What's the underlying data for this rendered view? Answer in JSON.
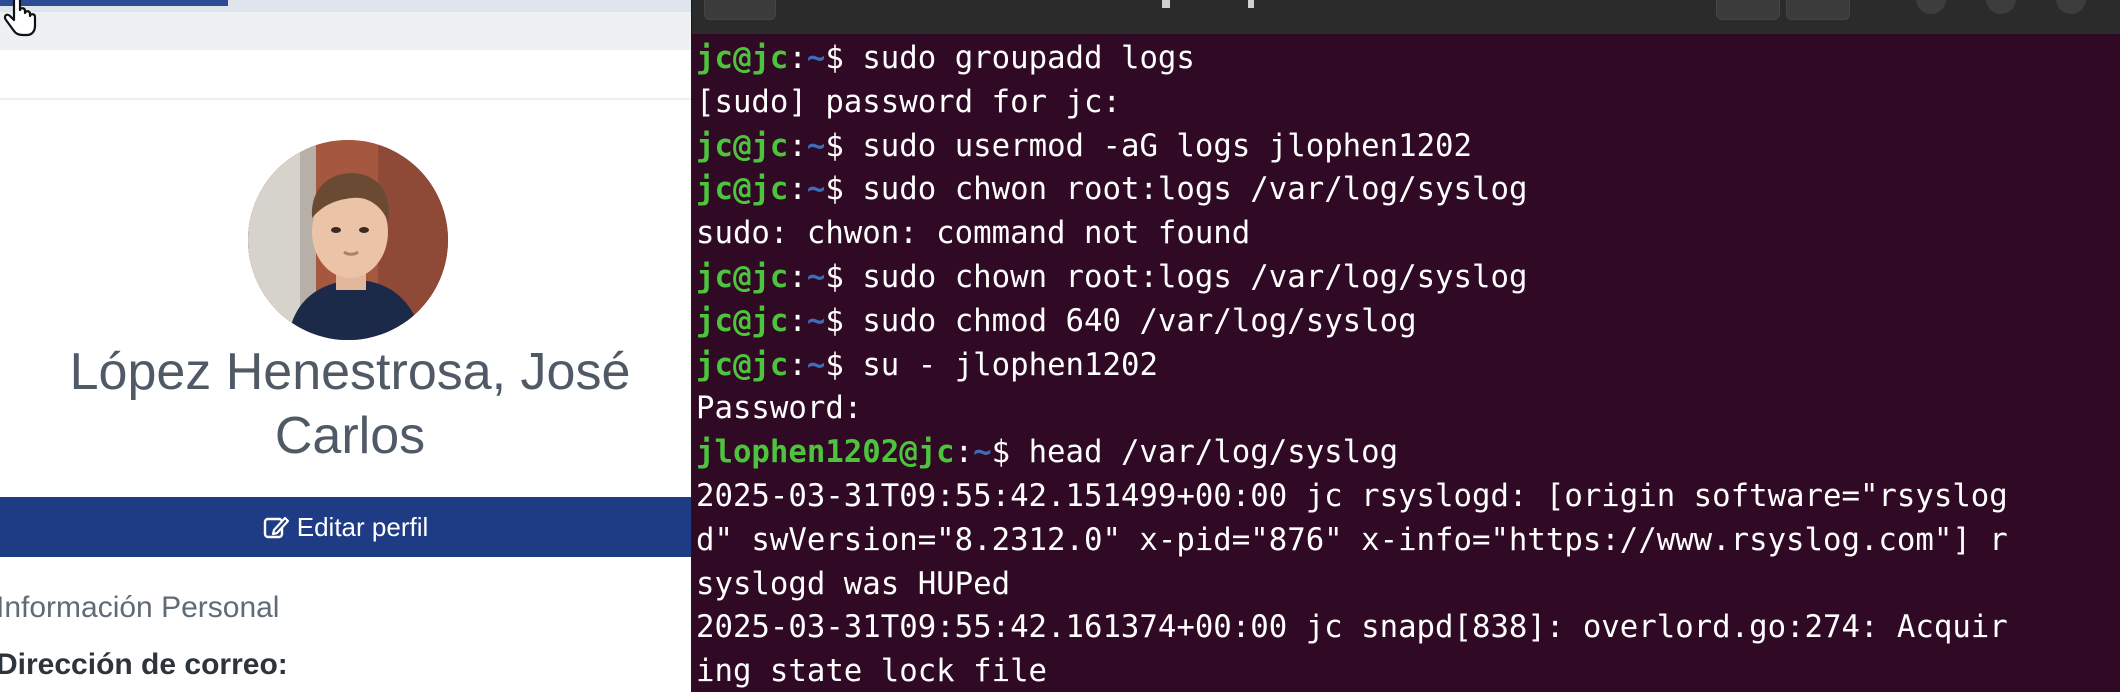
{
  "profile": {
    "name": "López Henestrosa, José Carlos",
    "edit_button_label": "Editar perfil",
    "section_title": "Información Personal",
    "email_label": "Dirección de correo:",
    "progress_fraction": 0.33,
    "accent_color": "#1d3c85"
  },
  "terminal": {
    "background_color": "#300a24",
    "prompt_user_color": "#4cc43c",
    "prompt_path_color": "#3d6db9",
    "lines": [
      {
        "user": "jc@jc",
        "path": "~",
        "text": "sudo groupadd logs"
      },
      {
        "text": "[sudo] password for jc:"
      },
      {
        "user": "jc@jc",
        "path": "~",
        "text": "sudo usermod -aG logs jlophen1202"
      },
      {
        "user": "jc@jc",
        "path": "~",
        "text": "sudo chwon root:logs /var/log/syslog"
      },
      {
        "text": "sudo: chwon: command not found"
      },
      {
        "user": "jc@jc",
        "path": "~",
        "text": "sudo chown root:logs /var/log/syslog"
      },
      {
        "user": "jc@jc",
        "path": "~",
        "text": "sudo chmod 640 /var/log/syslog"
      },
      {
        "user": "jc@jc",
        "path": "~",
        "text": "su - jlophen1202"
      },
      {
        "text": "Password:"
      },
      {
        "user": "jlophen1202@jc",
        "path": "~",
        "text": "head /var/log/syslog"
      },
      {
        "text": "2025-03-31T09:55:42.151499+00:00 jc rsyslogd: [origin software=\"rsyslog"
      },
      {
        "text": "d\" swVersion=\"8.2312.0\" x-pid=\"876\" x-info=\"https://www.rsyslog.com\"] r"
      },
      {
        "text": "syslogd was HUPed"
      },
      {
        "text": "2025-03-31T09:55:42.161374+00:00 jc snapd[838]: overlord.go:274: Acquir"
      },
      {
        "text": "ing state lock file"
      }
    ]
  }
}
